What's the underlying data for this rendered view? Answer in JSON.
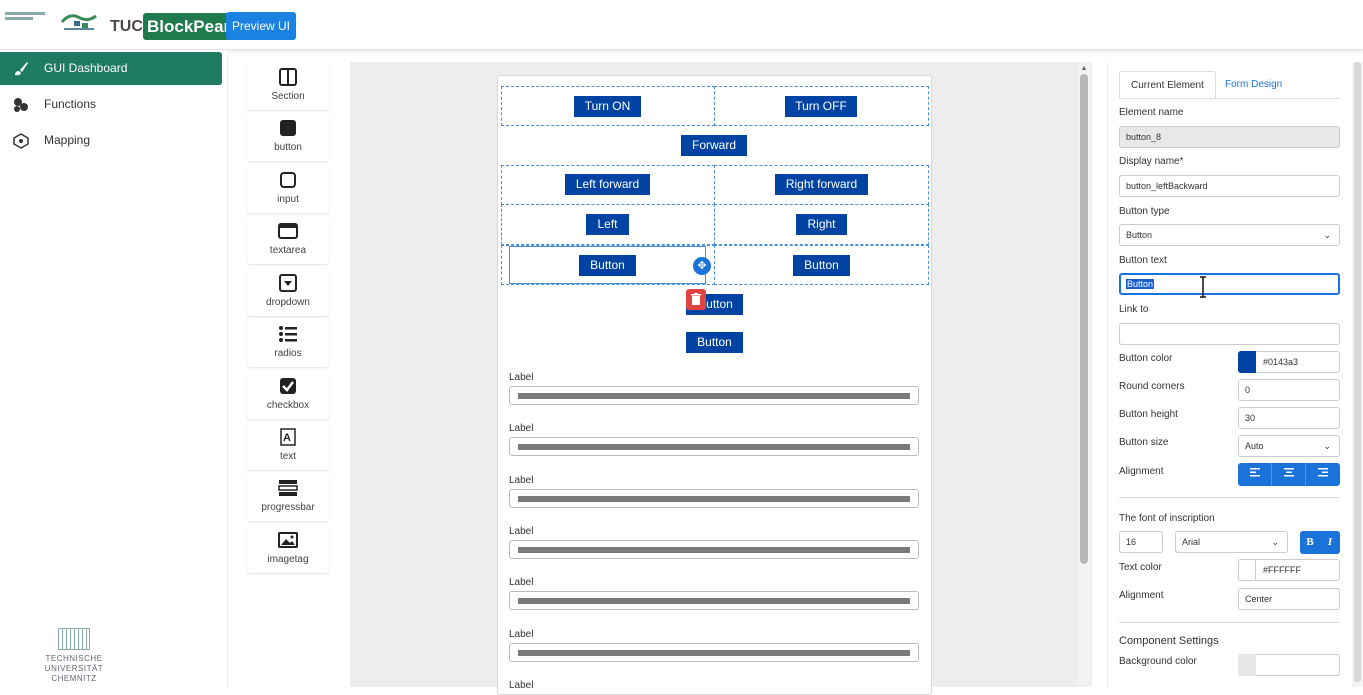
{
  "header": {
    "brand_prefix": "TUC",
    "brand_name": "BlockPearl",
    "preview_button": "Preview UI"
  },
  "sidebar": {
    "items": [
      {
        "label": "GUI Dashboard",
        "icon": "brush-icon",
        "active": true
      },
      {
        "label": "Functions",
        "icon": "functions-icon",
        "active": false
      },
      {
        "label": "Mapping",
        "icon": "mapping-icon",
        "active": false
      }
    ],
    "footer": {
      "line1": "TECHNISCHE UNIVERSITÄT",
      "line2": "CHEMNITZ"
    }
  },
  "toolbox": [
    {
      "label": "Section",
      "icon": "section-icon"
    },
    {
      "label": "button",
      "icon": "button-icon"
    },
    {
      "label": "input",
      "icon": "input-icon"
    },
    {
      "label": "textarea",
      "icon": "textarea-icon"
    },
    {
      "label": "dropdown",
      "icon": "dropdown-icon"
    },
    {
      "label": "radios",
      "icon": "radios-icon"
    },
    {
      "label": "checkbox",
      "icon": "checkbox-icon"
    },
    {
      "label": "text",
      "icon": "text-icon"
    },
    {
      "label": "progressbar",
      "icon": "progressbar-icon"
    },
    {
      "label": "imagetag",
      "icon": "imagetag-icon"
    }
  ],
  "canvas": {
    "buttons": {
      "turn_on": "Turn ON",
      "turn_off": "Turn OFF",
      "forward": "Forward",
      "left_forward": "Left forward",
      "right_forward": "Right forward",
      "left": "Left",
      "right": "Right",
      "button_selected": "Button",
      "button_right": "Button",
      "button_mid": "utton",
      "button_bottom": "Button"
    },
    "labels": [
      "Label",
      "Label",
      "Label",
      "Label",
      "Label",
      "Label",
      "Label"
    ]
  },
  "properties": {
    "tabs": {
      "current": "Current Element",
      "form": "Form Design"
    },
    "element_name_label": "Element name",
    "element_name": "button_8",
    "display_name_label": "Display name*",
    "display_name": "button_leftBackward",
    "button_type_label": "Button type",
    "button_type": "Button",
    "button_text_label": "Button text",
    "button_text": "Button",
    "link_to_label": "Link to",
    "link_to": "",
    "button_color_label": "Button color",
    "button_color": "#0143a3",
    "round_corners_label": "Round corners",
    "round_corners": "0",
    "button_height_label": "Button height",
    "button_height": "30",
    "button_size_label": "Button size",
    "button_size": "Auto",
    "alignment_label": "Alignment",
    "font_section_label": "The font of inscription",
    "font_size": "16",
    "font_family": "Arial",
    "bold": "B",
    "italic": "I",
    "text_color_label": "Text color",
    "text_color": "#FFFFFF",
    "text_alignment_label": "Alignment",
    "text_alignment": "Center",
    "component_settings_label": "Component Settings",
    "background_color_label": "Background color"
  },
  "colors": {
    "accent_green": "#1f7a62",
    "preview_blue": "#1a82e2",
    "button_blue": "#0143a3",
    "selection_blue": "#1a73d9"
  }
}
